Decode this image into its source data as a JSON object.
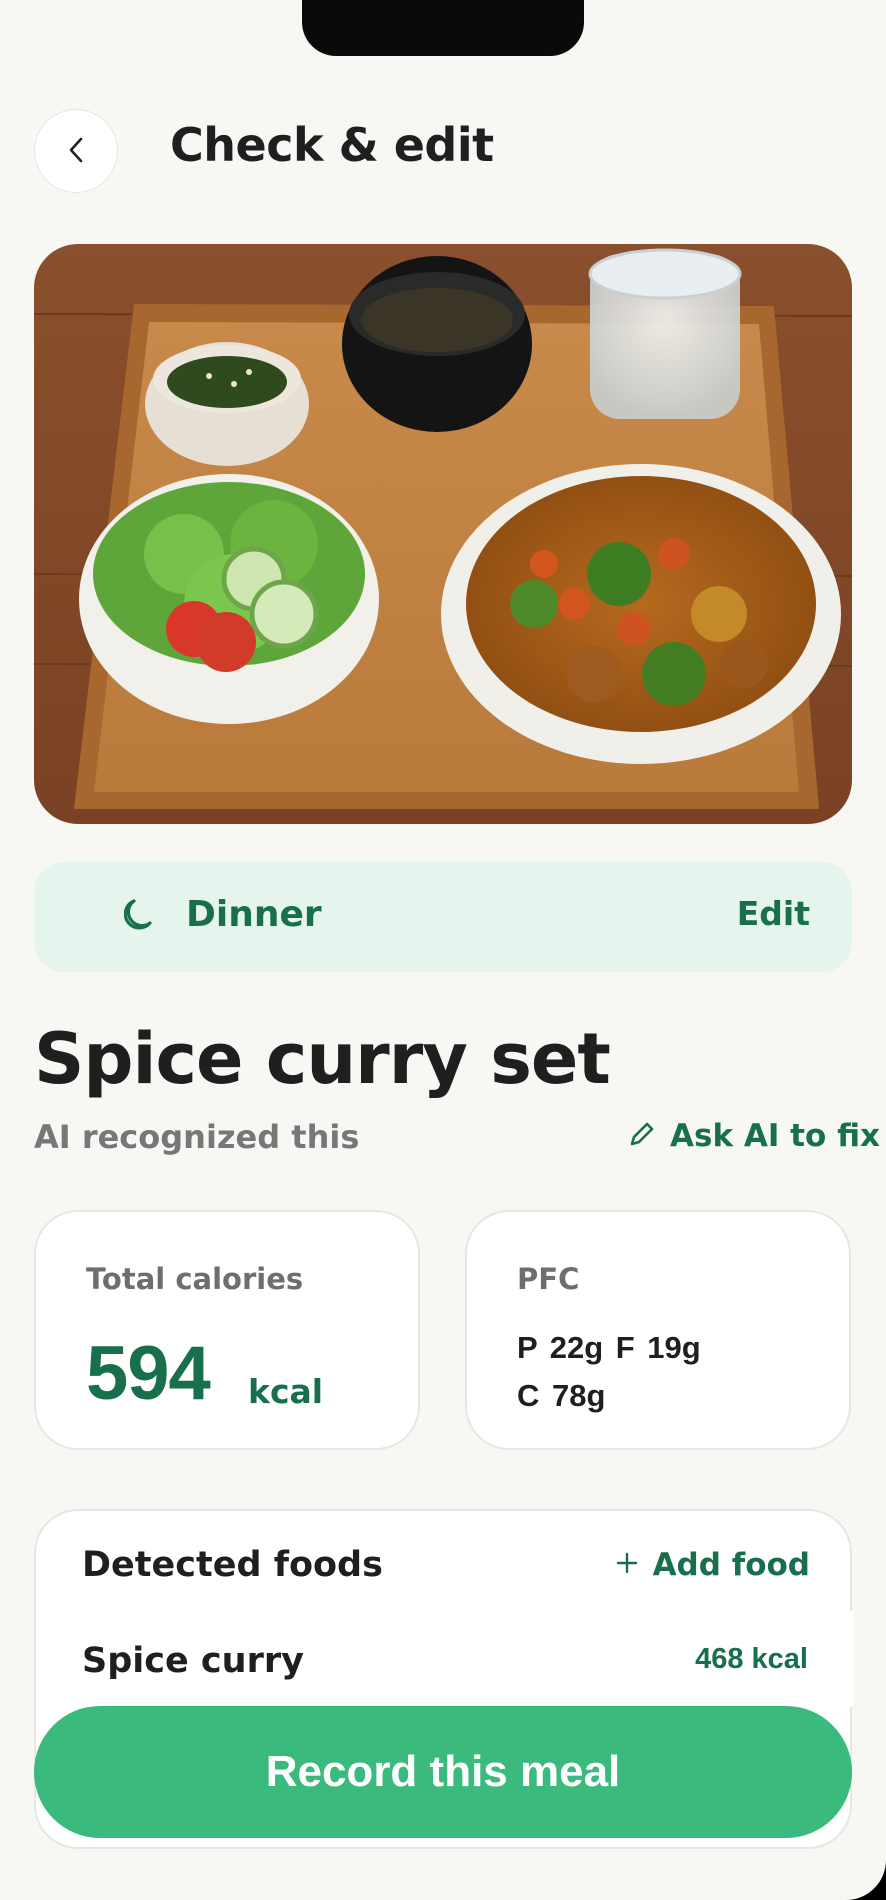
{
  "header": {
    "title": "Check & edit",
    "back_icon": "chevron-left-icon"
  },
  "photo": {
    "description_icon": "meal-photo"
  },
  "meal": {
    "type": "Dinner",
    "type_icon": "moon-icon",
    "edit_label": "Edit"
  },
  "dish": {
    "name": "Spice curry set",
    "ai_note": "AI recognized this",
    "ai_fix_label": "Ask AI to fix",
    "ai_fix_icon": "pencil-icon"
  },
  "calories": {
    "label": "Total calories",
    "value": "594",
    "unit": "kcal"
  },
  "pfc": {
    "label": "PFC",
    "line1": "P 22g  F 19g",
    "line2": "C 78g"
  },
  "foods": {
    "title": "Detected foods",
    "add_label": "Add food",
    "add_icon": "plus-icon",
    "items": [
      {
        "name": "Spice curry",
        "kcal": "468 kcal"
      }
    ]
  },
  "record_button": {
    "label": "Record this meal"
  },
  "colors": {
    "accent": "#17704b",
    "button": "#3bba7d",
    "meal_bar_bg": "#e6f4ee",
    "background": "#f7f7f4"
  }
}
